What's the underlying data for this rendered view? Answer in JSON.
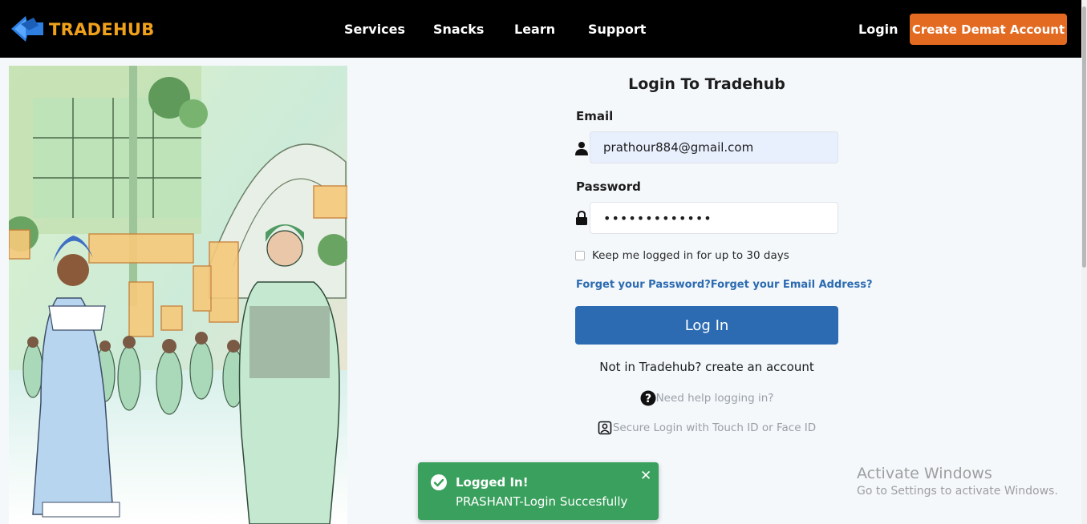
{
  "brand": {
    "name": "TRADEHUB",
    "color": "#f0a11b",
    "logo_icon": "blue-arrow-icon"
  },
  "nav": {
    "links": [
      {
        "label": "Services"
      },
      {
        "label": "Snacks"
      },
      {
        "label": "Learn"
      },
      {
        "label": "Support"
      }
    ],
    "login_label": "Login",
    "cta_label": "Create Demat Account",
    "cta_color": "#e36a21"
  },
  "form": {
    "title": "Login To Tradehub",
    "email_label": "Email",
    "email_value": "prathour884@gmail.com",
    "email_icon": "user-icon",
    "password_label": "Password",
    "password_value": "•••••••••••••",
    "password_icon": "lock-icon",
    "remember_label": "Keep me logged in for up to 30 days",
    "remember_checked": false,
    "forgot_password": "Forget your Password?",
    "forgot_email": "Forget your Email Address?",
    "login_button": "Log In",
    "signup_text": "Not in Tradehub? create an account",
    "help_text": "Need help logging in?",
    "help_icon": "question-circle-icon",
    "secure_text": "Secure Login with Touch ID or Face ID",
    "secure_icon": "face-id-icon",
    "primary_color": "#2c6bb1"
  },
  "toast": {
    "title": "Logged In!",
    "message": "PRASHANT-Login Succesfully",
    "color": "#3aa05d",
    "icon": "check-circle-icon"
  },
  "watermark": {
    "title": "Activate Windows",
    "subtitle": "Go to Settings to activate Windows."
  }
}
